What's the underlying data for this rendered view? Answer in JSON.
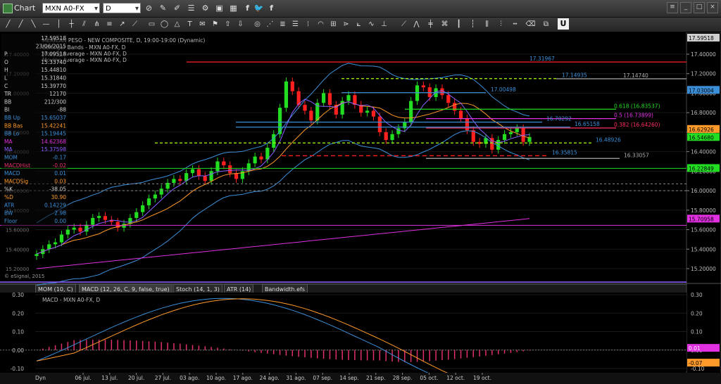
{
  "window": {
    "title": "Chart"
  },
  "toolbar": {
    "symbol": "MXN A0-FX",
    "interval": "D",
    "icons": [
      "link-icon",
      "edit-icon",
      "draw-icon",
      "list-icon",
      "settings-icon",
      "image-icon",
      "table-icon",
      "facebook-icon",
      "twitter-icon",
      "facebook-f-icon"
    ]
  },
  "drawtools": {
    "u_label": "U"
  },
  "legend": {
    "title": "MEXICAN PESO - NEW COMPOSITE, D, 19:00-19:00 (Dynamic)",
    "line2": "Bollinger Bands - MXN A0-FX, D",
    "line3": "Moving Average - MXN A0-FX, D",
    "line4": "Moving Average - MXN A0-FX, D"
  },
  "datawindow": [
    {
      "label": "",
      "value": "17.59518",
      "color": "#cfcfcf"
    },
    {
      "label": "",
      "value": "23/06/2015",
      "color": "#cfcfcf"
    },
    {
      "label": "P",
      "value": "17.09518",
      "color": "#cfcfcf"
    },
    {
      "label": "O",
      "value": "15.33740",
      "color": "#cfcfcf"
    },
    {
      "label": "H",
      "value": "15.44810",
      "color": "#cfcfcf"
    },
    {
      "label": "L",
      "value": "15.31840",
      "color": "#cfcfcf"
    },
    {
      "label": "C",
      "value": "15.39770",
      "color": "#cfcfcf"
    },
    {
      "label": "TR",
      "value": "12170",
      "color": "#cfcfcf"
    },
    {
      "label": "BB",
      "value": "212/300",
      "color": "#cfcfcf"
    },
    {
      "label": "BI",
      "value": "-88",
      "color": "#cfcfcf"
    },
    {
      "label": "BB Up",
      "value": "15.65037",
      "color": "#3b8fd9"
    },
    {
      "label": "BB Bas",
      "value": "15.42241",
      "color": "#ff9a2a"
    },
    {
      "label": "BB Lo",
      "value": "15.19445",
      "color": "#3b8fd9"
    },
    {
      "label": "MA",
      "value": "14.62368",
      "color": "#e030e0"
    },
    {
      "label": "MA",
      "value": "15.37598",
      "color": "#8a5cff"
    },
    {
      "label": "MOM",
      "value": "-0.17",
      "color": "#3b8fd9"
    },
    {
      "label": "MACDHist",
      "value": "-0.02",
      "color": "#e0306a"
    },
    {
      "label": "MACD",
      "value": "0.01",
      "color": "#3b8fd9"
    },
    {
      "label": "MACDSig",
      "value": "0.03",
      "color": "#ff9a2a"
    },
    {
      "label": "%K",
      "value": "-38.05",
      "color": "#cfcfcf"
    },
    {
      "label": "%D",
      "value": "30.90",
      "color": "#ff9a2a"
    },
    {
      "label": "ATR",
      "value": "0.14229",
      "color": "#3b8fd9"
    },
    {
      "label": "BW",
      "value": "2.98",
      "color": "#3b8fd9"
    },
    {
      "label": "Floor",
      "value": "0.00",
      "color": "#3b8fd9"
    }
  ],
  "copyright": "© eSignal, 2015",
  "price_axis": {
    "ticks": [
      "17.40000",
      "17.20000",
      "17.00000",
      "16.80000",
      "16.60000",
      "16.40000",
      "16.20000",
      "16.00000",
      "15.80000",
      "15.60000",
      "15.40000",
      "15.20000"
    ],
    "tags": [
      {
        "text": "17.59518",
        "bg": "#cfcfcf",
        "fg": "#000"
      },
      {
        "text": "17.03004",
        "bg": "#3b8fd9",
        "fg": "#000"
      },
      {
        "text": "16.62926",
        "bg": "#ff9a2a",
        "fg": "#000"
      },
      {
        "text": "16.54680",
        "bg": "#22dd22",
        "fg": "#000"
      },
      {
        "text": "16.22849",
        "bg": "#22dd22",
        "fg": "#000"
      },
      {
        "text": "15.70958",
        "bg": "#e030e0",
        "fg": "#000"
      }
    ]
  },
  "annotations": [
    {
      "text": "17.31967",
      "color": "#3b8fd9"
    },
    {
      "text": "17.14935",
      "color": "#3b8fd9"
    },
    {
      "text": "17.14740",
      "color": "#aaaaaa"
    },
    {
      "text": "17.00498",
      "color": "#3b8fd9"
    },
    {
      "text": "0.618 (16.83537)",
      "color": "#22dd22"
    },
    {
      "text": "0.5 (16.73899)",
      "color": "#e030e0"
    },
    {
      "text": "0.382 (16.64260)",
      "color": "#ff3060"
    },
    {
      "text": "16.70292",
      "color": "#3b8fd9"
    },
    {
      "text": "16.65158",
      "color": "#3b8fd9"
    },
    {
      "text": "16.48926",
      "color": "#3b8fd9"
    },
    {
      "text": "16.35815",
      "color": "#3b8fd9"
    },
    {
      "text": "16.33057",
      "color": "#aaaaaa"
    }
  ],
  "indicator_tabs": [
    "MOM (10, C)",
    "MACD (12, 26, C, 9, false, true)",
    "Stoch (14, 1, 3)",
    "ATR (14)",
    "Bandwidth.efs"
  ],
  "macd_panel": {
    "title": "MACD - MXN A0-FX, D",
    "ticks": [
      "0.30",
      "0.20",
      "0.10",
      "0.00",
      "-0.10"
    ],
    "tags": [
      {
        "text": "0.01",
        "bg": "#e030e0",
        "fg": "#fff"
      },
      {
        "text": "-0.07",
        "bg": "#ff9a2a",
        "fg": "#000"
      }
    ]
  },
  "date_axis": {
    "prefix": "Dyn",
    "labels": [
      "06 jul.",
      "13 jul.",
      "20 jul.",
      "27 jul.",
      "03 ago.",
      "10 ago.",
      "17 ago.",
      "24 ago.",
      "31 ago.",
      "07 sep.",
      "14 sep.",
      "21 sep.",
      "28 sep.",
      "05 oct.",
      "12 oct.",
      "19 oct."
    ]
  },
  "colors": {
    "up_candle": "#22dd22",
    "down_candle": "#ff2020",
    "bb": "#3b8fd9",
    "bb_mid": "#ff9a2a",
    "ma_slow": "#e030e0",
    "ma_fast": "#8a5cff"
  }
}
